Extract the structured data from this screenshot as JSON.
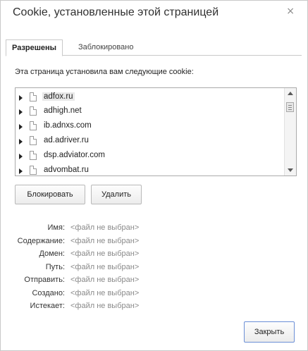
{
  "dialog": {
    "title": "Cookie, установленные этой страницей",
    "close_glyph": "×"
  },
  "tabs": [
    {
      "label": "Разрешены",
      "active": true
    },
    {
      "label": "Заблокировано",
      "active": false
    }
  ],
  "description": "Эта страница установила вам следующие cookie:",
  "cookies": [
    {
      "label": "adfox.ru",
      "selected": true
    },
    {
      "label": "adhigh.net",
      "selected": false
    },
    {
      "label": "ib.adnxs.com",
      "selected": false
    },
    {
      "label": "ad.adriver.ru",
      "selected": false
    },
    {
      "label": "dsp.adviator.com",
      "selected": false
    },
    {
      "label": "advombat.ru",
      "selected": false
    }
  ],
  "buttons": {
    "block": "Блокировать",
    "delete": "Удалить",
    "close": "Закрыть"
  },
  "details": [
    {
      "key": "Имя:",
      "value": "<файл не выбран>"
    },
    {
      "key": "Содержание:",
      "value": "<файл не выбран>"
    },
    {
      "key": "Домен:",
      "value": "<файл не выбран>"
    },
    {
      "key": "Путь:",
      "value": "<файл не выбран>"
    },
    {
      "key": "Отправить:",
      "value": "<файл не выбран>"
    },
    {
      "key": "Создано:",
      "value": "<файл не выбран>"
    },
    {
      "key": "Истекает:",
      "value": "<файл не выбран>"
    }
  ],
  "colors": {
    "default_button_border": "#6b8fd6",
    "placeholder_text": "#8a8a8a"
  }
}
